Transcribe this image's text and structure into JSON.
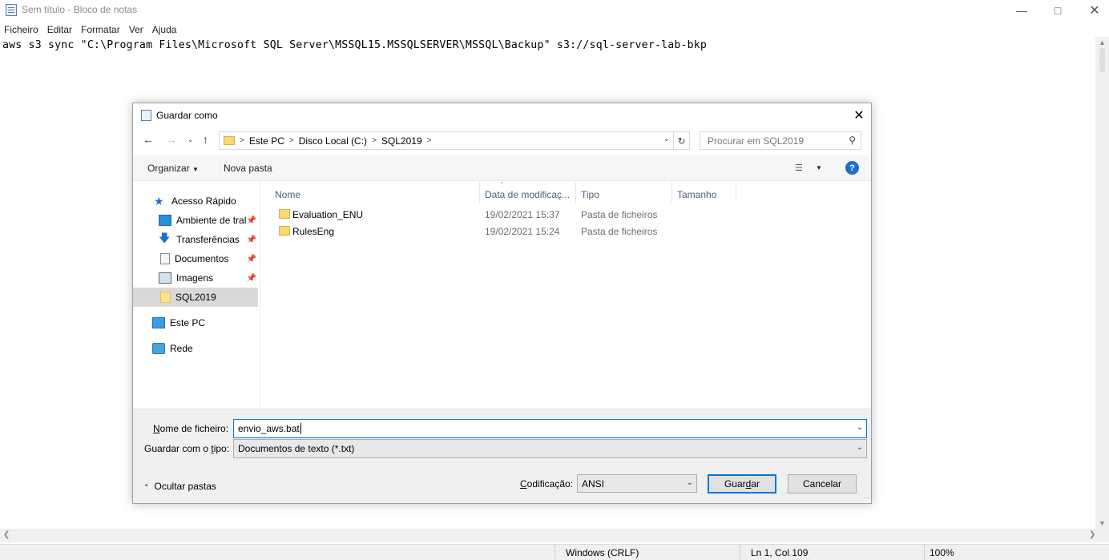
{
  "notepad": {
    "title": "Sem título - Bloco de notas",
    "menu": [
      "Ficheiro",
      "Editar",
      "Formatar",
      "Ver",
      "Ajuda"
    ],
    "content": "aws s3 sync \"C:\\Program Files\\Microsoft SQL Server\\MSSQL15.MSSQLSERVER\\MSSQL\\Backup\" s3://sql-server-lab-bkp",
    "status": {
      "line_ending": "Windows (CRLF)",
      "position": "Ln 1, Col 109",
      "zoom": "100%"
    }
  },
  "dialog": {
    "title": "Guardar como",
    "breadcrumb": [
      "Este PC",
      "Disco Local (C:)",
      "SQL2019"
    ],
    "search_placeholder": "Procurar em SQL2019",
    "organize": "Organizar",
    "new_folder": "Nova pasta",
    "help": "?",
    "nav": {
      "quick_access": "Acesso Rápido",
      "items": [
        "Ambiente de tral",
        "Transferências",
        "Documentos",
        "Imagens",
        "SQL2019"
      ],
      "this_pc": "Este PC",
      "network": "Rede"
    },
    "columns": [
      "Nome",
      "Data de modificaç...",
      "Tipo",
      "Tamanho"
    ],
    "files": [
      {
        "name": "Evaluation_ENU",
        "date": "19/02/2021 15:37",
        "type": "Pasta de ficheiros",
        "size": ""
      },
      {
        "name": "RulesEng",
        "date": "19/02/2021 15:24",
        "type": "Pasta de ficheiros",
        "size": ""
      }
    ],
    "filename_label_u": "N",
    "filename_label_rest": "ome de ficheiro:",
    "filename_value": "envio_aws.bat",
    "type_label_pre": "Guardar com o ",
    "type_label_u": "t",
    "type_label_post": "ipo:",
    "type_value": "Documentos de texto (*.txt)",
    "hide_folders": "Ocultar pastas",
    "encoding_label_u": "C",
    "encoding_label_rest": "odificação:",
    "encoding_value": "ANSI",
    "save_pre": "Guar",
    "save_u": "d",
    "save_post": "ar",
    "cancel": "Cancelar"
  }
}
